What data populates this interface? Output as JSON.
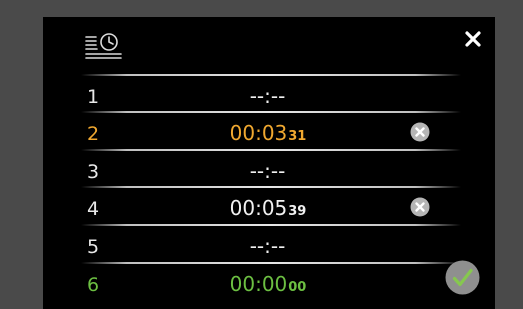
{
  "colors": {
    "active": "#f0a830",
    "new": "#6cbf42",
    "default": "#f0f0f0",
    "background": "#000000"
  },
  "header": {
    "icon": "timer-list-icon",
    "close_icon": "close-icon"
  },
  "timers": [
    {
      "index": "1",
      "time": "--:--",
      "seconds": "",
      "state": "empty"
    },
    {
      "index": "2",
      "time": "00:03",
      "seconds": "31",
      "state": "active",
      "clear_icon": "clear-icon"
    },
    {
      "index": "3",
      "time": "--:--",
      "seconds": "",
      "state": "empty"
    },
    {
      "index": "4",
      "time": "00:05",
      "seconds": "39",
      "state": "set",
      "clear_icon": "clear-icon"
    },
    {
      "index": "5",
      "time": "--:--",
      "seconds": "",
      "state": "empty"
    },
    {
      "index": "6",
      "time": "00:00",
      "seconds": "00",
      "state": "new"
    }
  ],
  "footer": {
    "confirm_icon": "check-icon"
  }
}
